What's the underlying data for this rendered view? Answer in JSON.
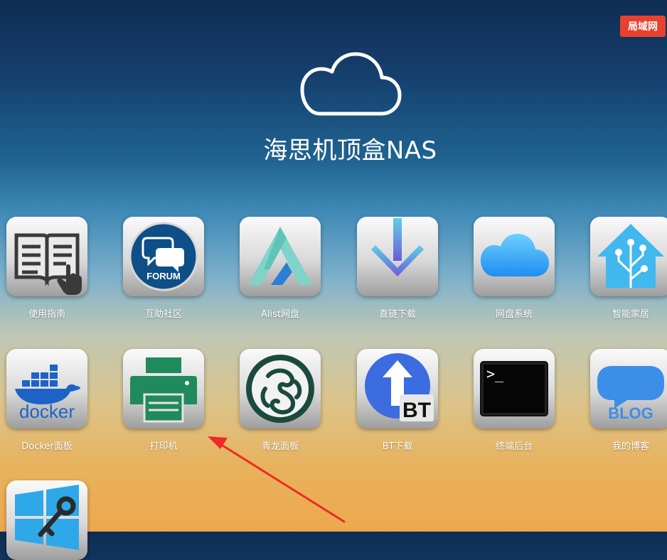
{
  "badge": "局域网",
  "header": {
    "title": "海思机顶盒NAS"
  },
  "apps": [
    {
      "label": "使用指南",
      "icon": "manual-book-icon"
    },
    {
      "label": "互助社区",
      "icon": "forum-icon",
      "icon_text": "FORUM"
    },
    {
      "label": "Alist网盘",
      "icon": "alist-icon"
    },
    {
      "label": "直链下载",
      "icon": "download-arrow-icon"
    },
    {
      "label": "网盘系统",
      "icon": "cloud-icon"
    },
    {
      "label": "智能家居",
      "icon": "smart-home-icon"
    },
    {
      "label": "Docker面板",
      "icon": "docker-icon",
      "icon_text": "docker"
    },
    {
      "label": "打印机",
      "icon": "printer-icon"
    },
    {
      "label": "青龙面板",
      "icon": "qinglong-dragon-icon"
    },
    {
      "label": "BT下载",
      "icon": "bt-icon",
      "icon_text": "BT"
    },
    {
      "label": "终端后台",
      "icon": "terminal-icon",
      "icon_text": ">_"
    },
    {
      "label": "我的博客",
      "icon": "blog-icon",
      "icon_text": "BLOG"
    },
    {
      "label": "",
      "icon": "windows-remote-icon"
    }
  ],
  "colors": {
    "badge": "#e8412f",
    "forum": "#0d4f86",
    "printer": "#1f8a5b",
    "bt": "#3d6be0",
    "docker": "#1d63c7"
  }
}
